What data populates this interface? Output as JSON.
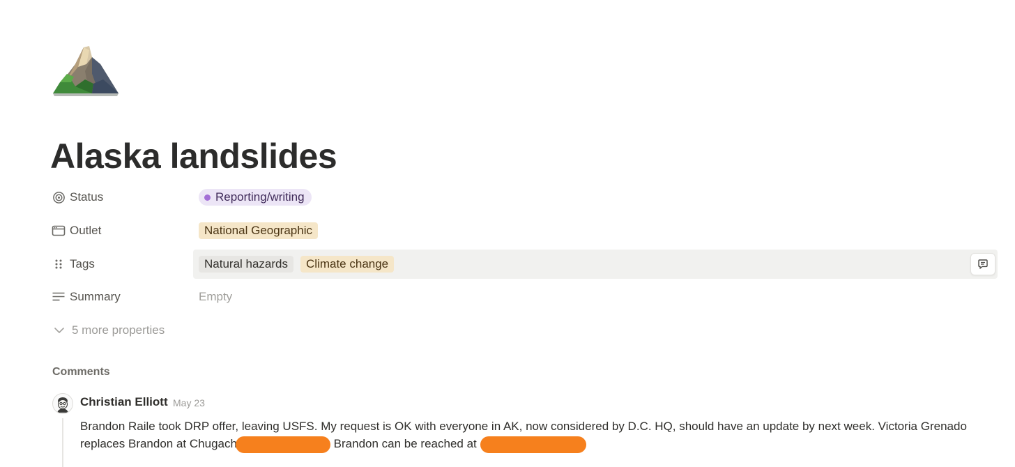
{
  "page": {
    "icon": "mountain-emoji-icon",
    "title": "Alaska landslides"
  },
  "properties": [
    {
      "name": "Status",
      "icon": "status-target-icon",
      "value": "Reporting/writing",
      "value_color": "#a36ed6"
    },
    {
      "name": "Outlet",
      "icon": "browser-window-icon",
      "value": "National Geographic"
    },
    {
      "name": "Tags",
      "icon": "drag-handle-icon",
      "values": [
        "Natural hazards",
        "Climate change"
      ]
    },
    {
      "name": "Summary",
      "icon": "lines-text-icon",
      "value": "Empty"
    }
  ],
  "more_properties_label": "5 more properties",
  "comments": {
    "heading": "Comments",
    "items": [
      {
        "author": "Christian Elliott",
        "date": "May 23",
        "text_part1": "Brandon Raile took DRP offer, leaving USFS. My request is OK with everyone in AK, now considered by D.C. HQ, should have an update by next week. Victoria Grenado replaces Brandon at Chugach",
        "text_part2": " Brandon can be reached at"
      }
    ]
  },
  "colors": {
    "status_pill_bg": "#ece5f6",
    "outlet_pill_bg": "#f5e6c8",
    "tag_gray_bg": "#e7e6e3",
    "redaction": "#f6801d"
  }
}
